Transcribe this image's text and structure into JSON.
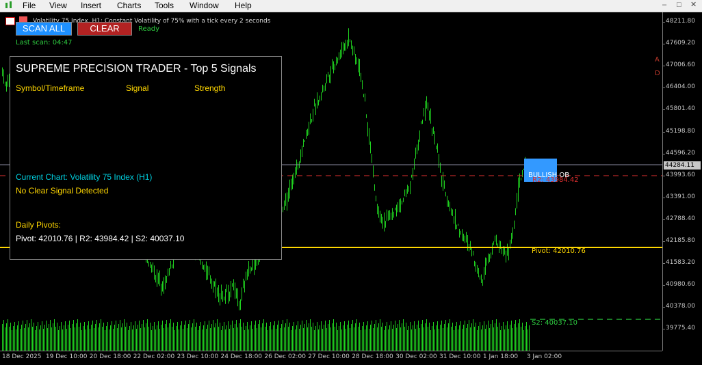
{
  "menu": {
    "items": [
      "File",
      "View",
      "Insert",
      "Charts",
      "Tools",
      "Window",
      "Help"
    ],
    "window_controls": [
      "–",
      "□",
      "✕"
    ]
  },
  "chart_header": {
    "title": "Volatility 75 Index, H1:  Constant Volatility of 75% with a tick every 2 seconds"
  },
  "ea": {
    "scan_all_label": "SCAN ALL",
    "clear_label": "CLEAR",
    "status": "Ready",
    "last_scan": "Last scan: 04:47"
  },
  "panel": {
    "title": "SUPREME PRECISION TRADER - Top 5 Signals",
    "col_symbol": "Symbol/Timeframe",
    "col_signal": "Signal",
    "col_strength": "Strength",
    "current_chart": "Current Chart: Volatility 75 Index (H1)",
    "no_signal": "No Clear Signal Detected",
    "pivots_heading": "Daily Pivots:",
    "pivots_line": "Pivot: 42010.76 | R2: 43984.42 | S2: 40037.10"
  },
  "annotations": {
    "pivot": "Pivot: 42010.76",
    "s2": "S2: 40037.10",
    "r2": "R2: 43984.42",
    "order_block": "BULLISH OB",
    "side_a": "A",
    "side_d": "D"
  },
  "price_axis": {
    "labels": [
      "48211.80",
      "47609.20",
      "47006.60",
      "46404.00",
      "45801.40",
      "45198.80",
      "44596.20",
      "43993.60",
      "43391.00",
      "42788.40",
      "42185.80",
      "41583.20",
      "40980.60",
      "40378.00",
      "39775.40"
    ],
    "current_price": "44284.11"
  },
  "time_axis": {
    "labels": [
      "18 Dec 2025",
      "19 Dec 10:00",
      "20 Dec 18:00",
      "22 Dec 02:00",
      "23 Dec 10:00",
      "24 Dec 18:00",
      "26 Dec 02:00",
      "27 Dec 10:00",
      "28 Dec 18:00",
      "30 Dec 02:00",
      "31 Dec 10:00",
      "1 Jan 18:00",
      "3 Jan 02:00"
    ]
  },
  "colors": {
    "candle": "#1fd01f",
    "pivot_line": "#ffd700",
    "r2_line": "#e03030",
    "s2_line": "#2ecc40",
    "bid_line": "#8a8aa0",
    "order_block": "#3399ff",
    "button_scan": "#1e90ff",
    "button_clear": "#b22222"
  },
  "chart_data": {
    "type": "candlestick",
    "path": [
      [
        0,
        47200
      ],
      [
        8,
        46400
      ],
      [
        18,
        46800
      ],
      [
        30,
        46000
      ],
      [
        45,
        45300
      ],
      [
        60,
        45000
      ],
      [
        80,
        44400
      ],
      [
        100,
        44200
      ],
      [
        120,
        44000
      ],
      [
        140,
        43600
      ],
      [
        160,
        43400
      ],
      [
        180,
        43100
      ],
      [
        200,
        42600
      ],
      [
        215,
        41700
      ],
      [
        228,
        41200
      ],
      [
        240,
        41000
      ],
      [
        255,
        41800
      ],
      [
        270,
        42200
      ],
      [
        285,
        41900
      ],
      [
        300,
        41400
      ],
      [
        315,
        40900
      ],
      [
        328,
        40600
      ],
      [
        340,
        41000
      ],
      [
        350,
        40400
      ],
      [
        362,
        41400
      ],
      [
        375,
        41700
      ],
      [
        390,
        42000
      ],
      [
        405,
        42600
      ],
      [
        420,
        43400
      ],
      [
        432,
        44100
      ],
      [
        442,
        44800
      ],
      [
        455,
        45600
      ],
      [
        466,
        46100
      ],
      [
        478,
        46700
      ],
      [
        490,
        47100
      ],
      [
        502,
        47500
      ],
      [
        510,
        47800
      ],
      [
        518,
        47300
      ],
      [
        526,
        46900
      ],
      [
        534,
        45800
      ],
      [
        542,
        44600
      ],
      [
        550,
        43200
      ],
      [
        560,
        42700
      ],
      [
        572,
        42900
      ],
      [
        585,
        43200
      ],
      [
        598,
        43700
      ],
      [
        610,
        44800
      ],
      [
        618,
        45600
      ],
      [
        624,
        45900
      ],
      [
        630,
        45500
      ],
      [
        638,
        44700
      ],
      [
        646,
        43800
      ],
      [
        656,
        43200
      ],
      [
        666,
        42700
      ],
      [
        676,
        42300
      ],
      [
        688,
        42000
      ],
      [
        696,
        41500
      ],
      [
        704,
        41100
      ],
      [
        712,
        41700
      ],
      [
        722,
        42200
      ],
      [
        732,
        42000
      ],
      [
        742,
        41800
      ],
      [
        750,
        42500
      ],
      [
        756,
        43500
      ],
      [
        762,
        44000
      ],
      [
        768,
        44200
      ],
      [
        774,
        44150
      ]
    ],
    "volume_bars": true
  }
}
